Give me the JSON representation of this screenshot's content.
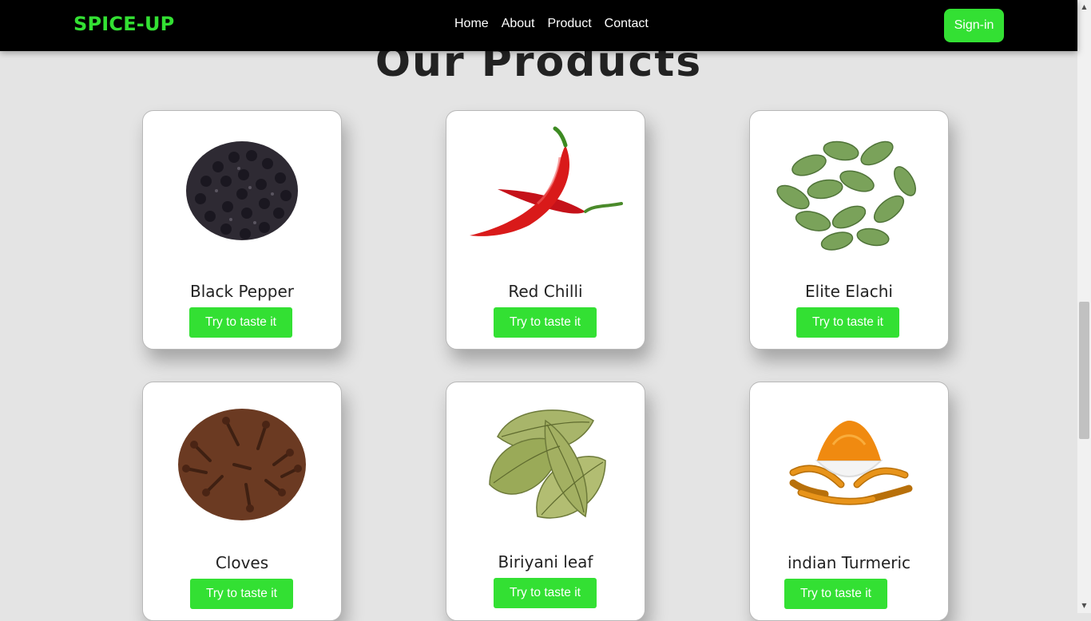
{
  "brand": {
    "logo": "SPICE-UP",
    "accent_color": "#33e033"
  },
  "nav": {
    "links": [
      "Home",
      "About",
      "Product",
      "Contact"
    ],
    "signin_label": "Sign-in"
  },
  "section": {
    "title": "Our Products"
  },
  "products": [
    {
      "name": "Black Pepper",
      "button": "Try to taste it",
      "image": "black-pepper-image"
    },
    {
      "name": "Red Chilli",
      "button": "Try to taste it",
      "image": "red-chilli-image"
    },
    {
      "name": "Elite Elachi",
      "button": "Try to taste it",
      "image": "cardamom-image"
    },
    {
      "name": "Cloves",
      "button": "Try to taste it",
      "image": "cloves-image"
    },
    {
      "name": "Biriyani leaf",
      "button": "Try to taste it",
      "image": "bay-leaf-image"
    },
    {
      "name": "indian Turmeric",
      "button": "Try to taste it",
      "image": "turmeric-image"
    }
  ]
}
